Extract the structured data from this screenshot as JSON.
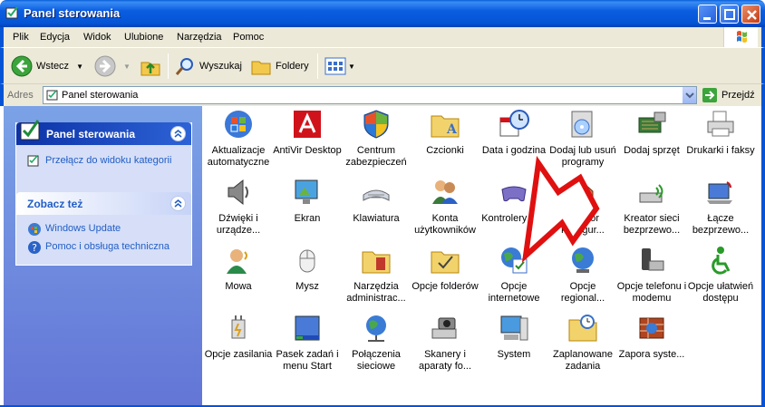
{
  "window": {
    "title": "Panel sterowania"
  },
  "menu": [
    "Plik",
    "Edycja",
    "Widok",
    "Ulubione",
    "Narzędzia",
    "Pomoc"
  ],
  "toolbar": {
    "back": "Wstecz",
    "search": "Wyszukaj",
    "folders": "Foldery"
  },
  "address": {
    "label": "Adres",
    "value": "Panel sterowania",
    "go": "Przejdź"
  },
  "sidebar": {
    "panel_title": "Panel sterowania",
    "switch_link": "Przełącz do widoku kategorii",
    "see_also_title": "Zobacz też",
    "links": [
      "Windows Update",
      "Pomoc i obsługa techniczna"
    ]
  },
  "items": [
    {
      "label": "Aktualizacje automatyczne",
      "icon": "windows-update-icon"
    },
    {
      "label": "AntiVir Desktop",
      "icon": "antivir-icon"
    },
    {
      "label": "Centrum zabezpieczeń",
      "icon": "security-shield-icon"
    },
    {
      "label": "Czcionki",
      "icon": "fonts-folder-icon"
    },
    {
      "label": "Data i godzina",
      "icon": "clock-icon"
    },
    {
      "label": "Dodaj lub usuń programy",
      "icon": "add-remove-programs-icon"
    },
    {
      "label": "Dodaj sprzęt",
      "icon": "add-hardware-icon"
    },
    {
      "label": "Drukarki i faksy",
      "icon": "printer-icon"
    },
    {
      "label": "Dźwięki i urządze...",
      "icon": "speaker-icon"
    },
    {
      "label": "Ekran",
      "icon": "display-icon"
    },
    {
      "label": "Klawiatura",
      "icon": "keyboard-icon"
    },
    {
      "label": "Konta użytkowników",
      "icon": "users-icon"
    },
    {
      "label": "Kontrolery gier",
      "icon": "gamepad-icon"
    },
    {
      "label": "Kreator konfigur...",
      "icon": "network-wizard-icon"
    },
    {
      "label": "Kreator sieci bezprzewo...",
      "icon": "wireless-icon"
    },
    {
      "label": "Łącze bezprzewo...",
      "icon": "wireless-link-icon"
    },
    {
      "label": "Mowa",
      "icon": "speech-icon"
    },
    {
      "label": "Mysz",
      "icon": "mouse-icon"
    },
    {
      "label": "Narzędzia administrac...",
      "icon": "admin-tools-icon"
    },
    {
      "label": "Opcje folderów",
      "icon": "folder-options-icon"
    },
    {
      "label": "Opcje internetowe",
      "icon": "internet-options-icon"
    },
    {
      "label": "Opcje regional...",
      "icon": "globe-icon"
    },
    {
      "label": "Opcje telefonu i modemu",
      "icon": "phone-modem-icon"
    },
    {
      "label": "Opcje ułatwień dostępu",
      "icon": "accessibility-icon"
    },
    {
      "label": "Opcje zasilania",
      "icon": "power-icon"
    },
    {
      "label": "Pasek zadań i menu Start",
      "icon": "taskbar-icon"
    },
    {
      "label": "Połączenia sieciowe",
      "icon": "network-connections-icon"
    },
    {
      "label": "Skanery i aparaty fo...",
      "icon": "scanner-camera-icon"
    },
    {
      "label": "System",
      "icon": "system-icon"
    },
    {
      "label": "Zaplanowane zadania",
      "icon": "scheduled-tasks-icon"
    },
    {
      "label": "Zapora syste...",
      "icon": "firewall-icon"
    }
  ]
}
